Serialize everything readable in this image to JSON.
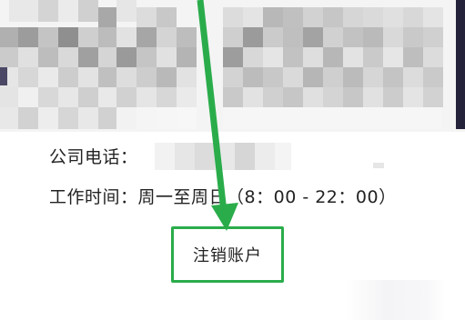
{
  "company_phone": {
    "label": "公司电话："
  },
  "work_hours": {
    "label": "工作时间：",
    "value": "周一至周日（8：00 - 22：00）"
  },
  "deregister_button": {
    "label": "注销账户"
  },
  "colors": {
    "annotation_green": "#2aac4b",
    "text": "#222222",
    "background": "#ffffff"
  },
  "icons": {
    "annotation": "arrow-down-icon"
  }
}
